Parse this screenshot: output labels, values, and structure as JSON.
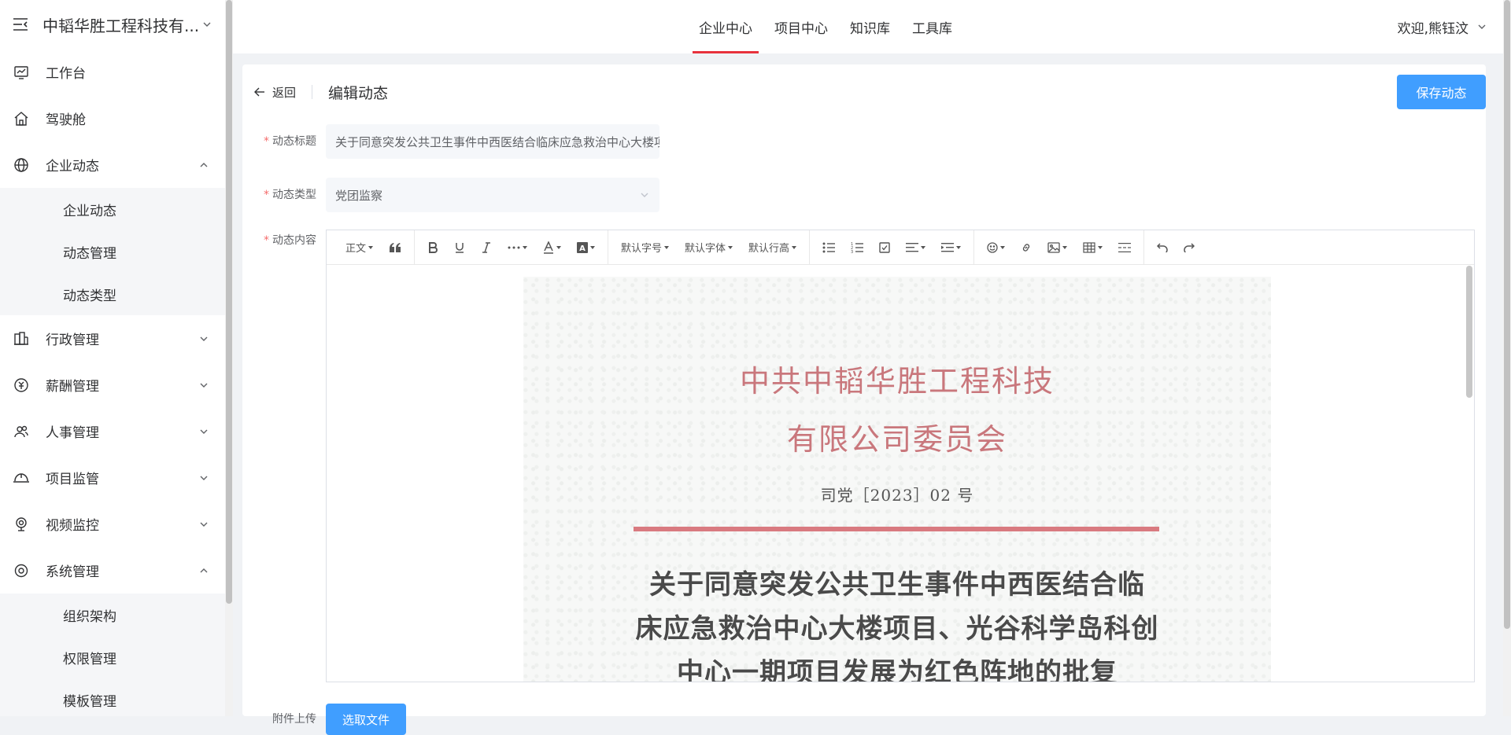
{
  "sidebar": {
    "company": "中韬华胜工程科技有...",
    "items": [
      {
        "label": "工作台",
        "icon": "dashboard-icon"
      },
      {
        "label": "驾驶舱",
        "icon": "home-icon"
      },
      {
        "label": "企业动态",
        "icon": "globe-icon",
        "expanded": true,
        "children": [
          "企业动态",
          "动态管理",
          "动态类型"
        ]
      },
      {
        "label": "行政管理",
        "icon": "building-icon"
      },
      {
        "label": "薪酬管理",
        "icon": "salary-icon"
      },
      {
        "label": "人事管理",
        "icon": "users-icon"
      },
      {
        "label": "项目监管",
        "icon": "helmet-icon"
      },
      {
        "label": "视频监控",
        "icon": "camera-icon"
      },
      {
        "label": "系统管理",
        "icon": "settings-icon",
        "expanded": true,
        "children": [
          "组织架构",
          "权限管理",
          "模板管理"
        ]
      }
    ]
  },
  "topnav": {
    "tabs": [
      "企业中心",
      "项目中心",
      "知识库",
      "工具库"
    ],
    "active_tab": "企业中心",
    "welcome": "欢迎,熊钰汶"
  },
  "page": {
    "back_label": "返回",
    "title": "编辑动态",
    "save_label": "保存动态"
  },
  "form": {
    "title_label": "动态标题",
    "title_value": "关于同意突发公共卫生事件中西医结合临床应急救治中心大楼项目",
    "type_label": "动态类型",
    "type_value": "党团监察",
    "content_label": "动态内容",
    "upload_label": "附件上传",
    "upload_button": "选取文件"
  },
  "editor": {
    "toolbar": {
      "paragraph": "正文",
      "font_size": "默认字号",
      "font_family": "默认字体",
      "line_height": "默认行高"
    },
    "document": {
      "org_line1": "中共中韬华胜工程科技",
      "org_line2": "有限公司委员会",
      "doc_number": "司党［2023］02 号",
      "subject_line1": "关于同意突发公共卫生事件中西医结合临",
      "subject_line2": "床应急救治中心大楼项目、光谷科学岛科创",
      "subject_line3": "中心一期项目发展为红色阵地的批复"
    }
  },
  "colors": {
    "primary": "#409eff",
    "active_tab_underline": "#e8323c",
    "required": "#f56c6c",
    "doc_red": "#c9777c"
  }
}
